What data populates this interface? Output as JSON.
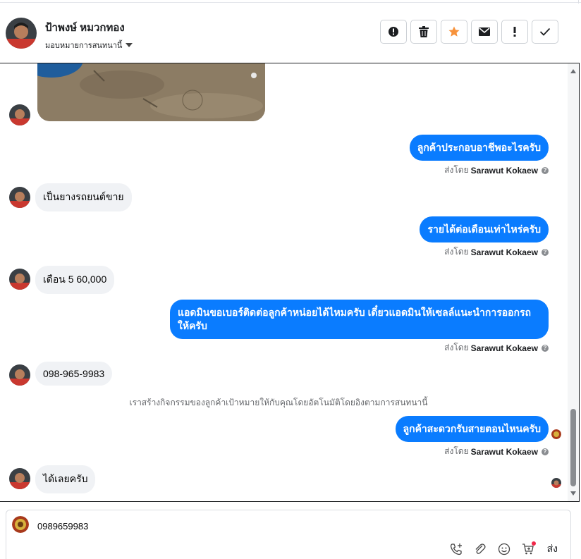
{
  "header": {
    "contact_name": "ป้าพงษ์ หมวกทอง",
    "assign_label": "มอบหมายการสนทนานี้"
  },
  "actions": [
    {
      "name": "report-spam-button",
      "icon": "alert-circle-icon"
    },
    {
      "name": "delete-button",
      "icon": "trash-icon"
    },
    {
      "name": "star-button",
      "icon": "star-icon"
    },
    {
      "name": "mark-unread-button",
      "icon": "envelope-icon"
    },
    {
      "name": "important-button",
      "icon": "exclamation-icon"
    },
    {
      "name": "done-button",
      "icon": "check-icon"
    }
  ],
  "colors": {
    "outgoing_bubble": "#0a7cff",
    "incoming_bubble": "#f0f2f5",
    "star": "#f7923b",
    "notification_dot": "#f02849"
  },
  "messages": {
    "out1": "ลูกค้าประกอบอาชีพอะไรครับ",
    "in1": "เป็นยางรถยนต์ขาย",
    "out2": "รายได้ต่อเดือนเท่าไหร่ครับ",
    "in2": "เดือน 5 60,000",
    "out3": "แอดมินขอเบอร์ติดต่อลูกค้าหน่อยได้ไหมครับ เดี๋ยวแอดมินให้เซลล์แนะนำการออกรถให้ครับ",
    "in3": "098-965-9983",
    "system_note": "เราสร้างกิจกรรมของลูกค้าเป้าหมายให้กับคุณโดยอัตโนมัติโดยอิงตามการสนทนานี้",
    "out4": "ลูกค้าสะดวกรับสายตอนไหนครับ",
    "in4": "ได้เลยครับ"
  },
  "sent_by": {
    "prefix": "ส่งโดย",
    "agent": "Sarawut Kokaew",
    "help": "?"
  },
  "composer": {
    "text": "0989659983",
    "send_label": "ส่ง",
    "tools": [
      "phone-plus-icon",
      "paperclip-icon",
      "emoji-icon",
      "cart-plus-icon"
    ]
  }
}
